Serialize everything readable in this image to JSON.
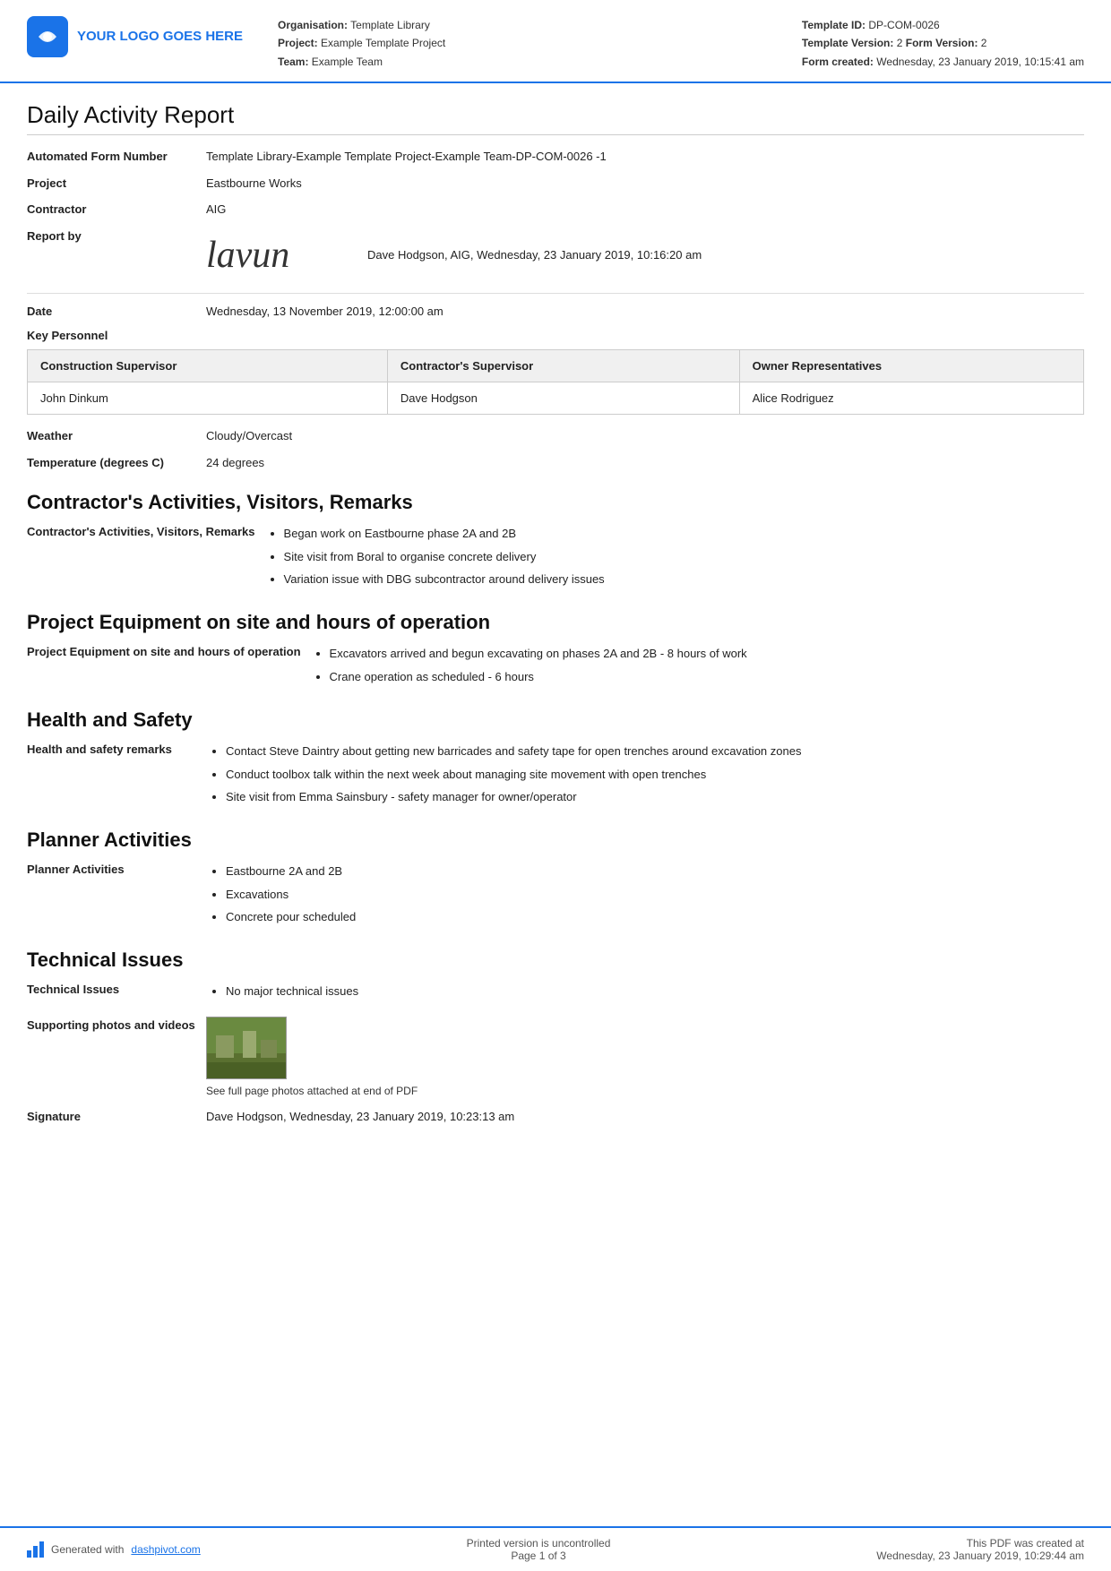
{
  "header": {
    "logo_text": "YOUR LOGO GOES HERE",
    "org_label": "Organisation:",
    "org_value": "Template Library",
    "project_label": "Project:",
    "project_value": "Example Template Project",
    "team_label": "Team:",
    "team_value": "Example Team",
    "template_id_label": "Template ID:",
    "template_id_value": "DP-COM-0026",
    "template_version_label": "Template Version:",
    "template_version_value": "2",
    "form_version_label": "Form Version:",
    "form_version_value": "2",
    "form_created_label": "Form created:",
    "form_created_value": "Wednesday, 23 January 2019, 10:15:41 am"
  },
  "report": {
    "title": "Daily Activity Report",
    "form_number_label": "Automated Form Number",
    "form_number_value": "Template Library-Example Template Project-Example Team-DP-COM-0026   -1",
    "project_label": "Project",
    "project_value": "Eastbourne Works",
    "contractor_label": "Contractor",
    "contractor_value": "AIG",
    "report_by_label": "Report by",
    "report_by_sig_text": "lavun",
    "report_by_value": "Dave Hodgson, AIG, Wednesday, 23 January 2019, 10:16:20 am",
    "date_label": "Date",
    "date_value": "Wednesday, 13 November 2019, 12:00:00 am"
  },
  "key_personnel": {
    "label": "Key Personnel",
    "col1": "Construction Supervisor",
    "col2": "Contractor's Supervisor",
    "col3": "Owner Representatives",
    "row1_col1": "John Dinkum",
    "row1_col2": "Dave Hodgson",
    "row1_col3": "Alice Rodriguez"
  },
  "weather": {
    "label": "Weather",
    "value": "Cloudy/Overcast",
    "temp_label": "Temperature (degrees C)",
    "temp_value": "24 degrees"
  },
  "contractors_section": {
    "title": "Contractor's Activities, Visitors, Remarks",
    "field_label": "Contractor's Activities, Visitors, Remarks",
    "items": [
      "Began work on Eastbourne phase 2A and 2B",
      "Site visit from Boral to organise concrete delivery",
      "Variation issue with DBG subcontractor around delivery issues"
    ]
  },
  "equipment_section": {
    "title": "Project Equipment on site and hours of operation",
    "field_label": "Project Equipment on site and hours of operation",
    "items": [
      "Excavators arrived and begun excavating on phases 2A and 2B - 8 hours of work",
      "Crane operation as scheduled - 6 hours"
    ]
  },
  "health_section": {
    "title": "Health and Safety",
    "field_label": "Health and safety remarks",
    "items": [
      "Contact Steve Daintry about getting new barricades and safety tape for open trenches around excavation zones",
      "Conduct toolbox talk within the next week about managing site movement with open trenches",
      "Site visit from Emma Sainsbury - safety manager for owner/operator"
    ]
  },
  "planner_section": {
    "title": "Planner Activities",
    "field_label": "Planner Activities",
    "items": [
      "Eastbourne 2A and 2B",
      "Excavations",
      "Concrete pour scheduled"
    ]
  },
  "technical_section": {
    "title": "Technical Issues",
    "field_label": "Technical Issues",
    "items": [
      "No major technical issues"
    ],
    "photos_label": "Supporting photos and videos",
    "photos_caption": "See full page photos attached at end of PDF",
    "signature_label": "Signature",
    "signature_value": "Dave Hodgson, Wednesday, 23 January 2019, 10:23:13 am"
  },
  "footer": {
    "generated_text": "Generated with ",
    "generated_link": "dashpivot.com",
    "center_text": "Printed version is uncontrolled",
    "page_text": "Page 1 of 3",
    "right_text": "This PDF was created at",
    "right_date": "Wednesday, 23 January 2019, 10:29:44 am"
  }
}
